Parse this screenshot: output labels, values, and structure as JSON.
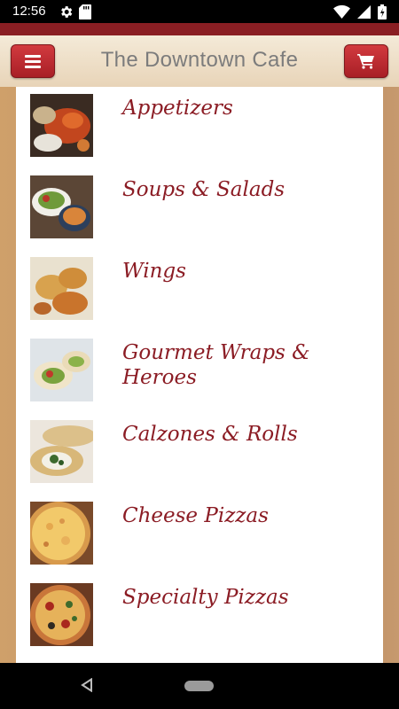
{
  "status_bar": {
    "time": "12:56",
    "left_icons": [
      "gear-icon",
      "sd-card-icon"
    ],
    "right_icons": [
      "wifi-icon",
      "signal-icon",
      "battery-icon"
    ]
  },
  "header": {
    "title": "The Downtown Cafe",
    "menu_button_icon": "hamburger-icon",
    "cart_button_icon": "cart-icon",
    "accent_color": "#8a1e23",
    "button_color": "#c0282e"
  },
  "menu": {
    "categories": [
      {
        "label": "Appetizers",
        "image": "appetizers-photo"
      },
      {
        "label": "Soups & Salads",
        "image": "soups-salads-photo"
      },
      {
        "label": "Wings",
        "image": "wings-photo"
      },
      {
        "label": "Gourmet Wraps & Heroes",
        "image": "wraps-heroes-photo"
      },
      {
        "label": "Calzones & Rolls",
        "image": "calzones-rolls-photo"
      },
      {
        "label": "Cheese Pizzas",
        "image": "cheese-pizza-photo"
      },
      {
        "label": "Specialty Pizzas",
        "image": "specialty-pizza-photo"
      }
    ],
    "label_color": "#8b1c24"
  },
  "nav_bar": {
    "icons": [
      "back-icon",
      "home-icon"
    ]
  }
}
